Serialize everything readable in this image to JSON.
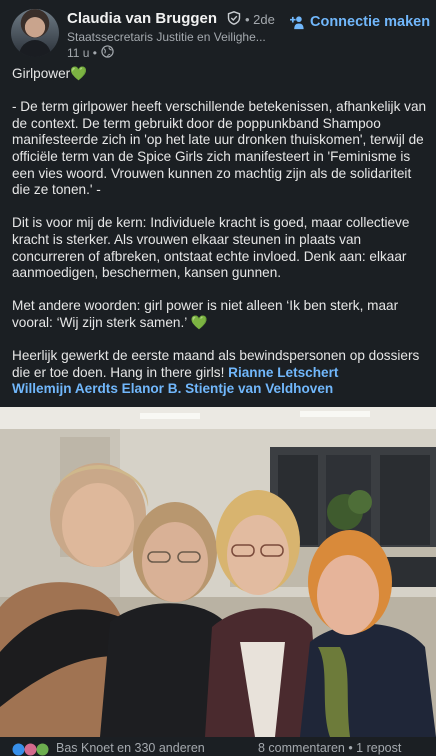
{
  "author": {
    "name": "Claudia van Bruggen",
    "degree": "• 2de",
    "headline": "Staatssecretaris Justitie en Veilighe...",
    "time": "11 u •",
    "connect_label": "Connectie maken"
  },
  "post": {
    "title": "Girlpower💚",
    "para1": "- De term girlpower heeft verschillende betekenissen, afhankelijk van de context. De term gebruikt door de poppunkband Shampoo manifesteerde zich in 'op het late uur dronken thuiskomen', terwijl de officiële term van de Spice Girls zich manifesteert in 'Feminisme is een vies woord. Vrouwen kunnen zo machtig zijn als de solidariteit die ze tonen.' -",
    "para2": "Dit is voor mij de kern: Individuele kracht is goed, maar collectieve kracht is sterker. Als vrouwen elkaar steunen in plaats van concurreren of afbreken, ontstaat echte invloed. Denk aan: elkaar aanmoedigen, beschermen, kansen gunnen.",
    "para3": "Met andere woorden: girl power is niet alleen ‘Ik ben sterk, maar vooral: ‘Wij zijn sterk samen.’ 💚",
    "para4_text": "Heerlijk gewerkt de eerste maand als bewindspersonen op dossiers die er toe doen. Hang in there girls! ",
    "mentions": [
      "Rianne Letschert",
      "Willemijn Aerdts",
      "Elanor B. Stientje van Veldhoven"
    ]
  },
  "footer": {
    "reactions": "Bas Knoet en 330 anderen",
    "comments": "8 commentaren • 1 repost"
  },
  "colors": {
    "background": "#1b1f23",
    "link": "#71b7fb",
    "muted": "#a4a9ae"
  }
}
